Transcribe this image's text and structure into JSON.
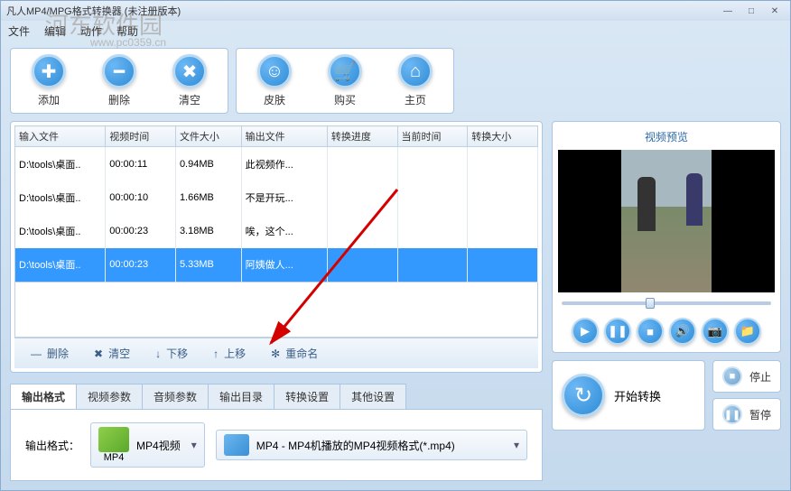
{
  "window": {
    "title": "凡人MP4/MPG格式转换器  (未注册版本)"
  },
  "menu": [
    "文件",
    "编辑",
    "动作",
    "帮助"
  ],
  "toolbar": {
    "add": "添加",
    "delete": "删除",
    "clear": "清空",
    "skin": "皮肤",
    "buy": "购买",
    "home": "主页"
  },
  "table": {
    "headers": [
      "输入文件",
      "视频时间",
      "文件大小",
      "输出文件",
      "转换进度",
      "当前时间",
      "转换大小"
    ],
    "rows": [
      {
        "input": "D:\\tools\\桌面..",
        "time": "00:00:11",
        "size": "0.94MB",
        "output": "此视频作...",
        "sel": false
      },
      {
        "input": "D:\\tools\\桌面..",
        "time": "00:00:10",
        "size": "1.66MB",
        "output": "不是开玩...",
        "sel": false
      },
      {
        "input": "D:\\tools\\桌面..",
        "time": "00:00:23",
        "size": "3.18MB",
        "output": "唉，这个...",
        "sel": false
      },
      {
        "input": "D:\\tools\\桌面..",
        "time": "00:00:23",
        "size": "5.33MB",
        "output": "阿姨做人...",
        "sel": true
      }
    ]
  },
  "table_footer": {
    "delete": "删除",
    "clear": "清空",
    "down": "下移",
    "up": "上移",
    "rename": "重命名"
  },
  "tabs": [
    "输出格式",
    "视频参数",
    "音频参数",
    "输出目录",
    "转换设置",
    "其他设置"
  ],
  "output": {
    "label": "输出格式：",
    "fmt_name": "MP4视频",
    "fmt_sub": "MP4",
    "desc": "MP4 - MP4机播放的MP4视频格式(*.mp4)"
  },
  "preview": {
    "title": "视频预览"
  },
  "actions": {
    "start": "开始转换",
    "stop": "停止",
    "pause": "暂停"
  },
  "watermark": {
    "text": "河东软件园",
    "url": "www.pc0359.cn"
  }
}
